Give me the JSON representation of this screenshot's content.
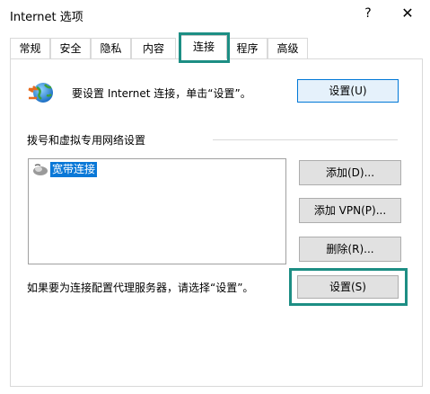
{
  "window": {
    "title": "Internet 选项",
    "help": "?",
    "close": "✕"
  },
  "tabs": [
    "常规",
    "安全",
    "隐私",
    "内容",
    "连接",
    "程序",
    "高级"
  ],
  "active_tab": "连接",
  "setup": {
    "text": "要设置 Internet 连接，单击“设置”。",
    "button": "设置(U)"
  },
  "dialup": {
    "section_label": "拨号和虚拟专用网络设置",
    "items": [
      "宽带连接"
    ],
    "buttons": {
      "add": "添加(D)...",
      "add_vpn": "添加 VPN(P)...",
      "delete": "删除(R)..."
    }
  },
  "proxy": {
    "text": "如果要为连接配置代理服务器，请选择“设置”。",
    "button": "设置(S)"
  },
  "colors": {
    "highlight": "#1d8e84",
    "selection": "#0a78d7"
  },
  "icons": {
    "globe": "network-globe-icon",
    "connection": "dialup-connection-icon"
  }
}
